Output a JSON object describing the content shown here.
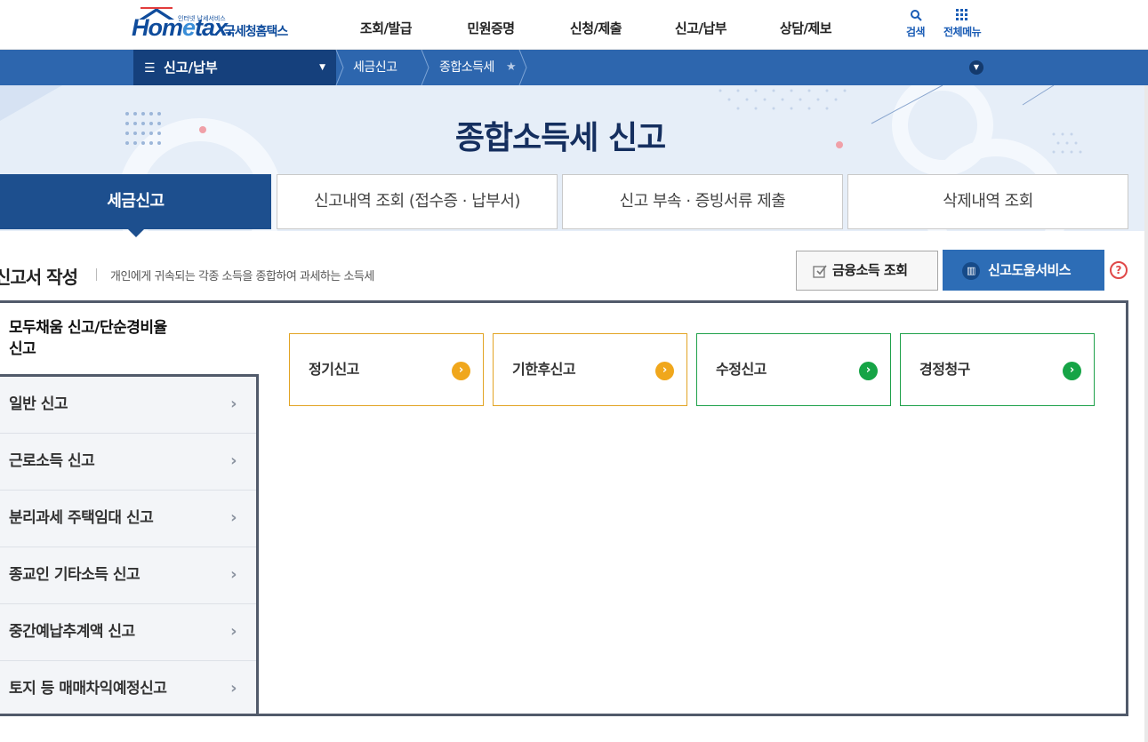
{
  "logo": {
    "brand_a": "Hom",
    "brand_e": "e",
    "brand_b": "tax.",
    "tagline": "인터넷 납세서비스",
    "agency": "국세청홈택스"
  },
  "gnb": [
    "조회/발급",
    "민원증명",
    "신청/제출",
    "신고/납부",
    "상담/제보"
  ],
  "util": {
    "search": "검색",
    "all_menu": "전체메뉴"
  },
  "navbar": {
    "menu": "신고/납부",
    "crumbs": [
      "세금신고",
      "종합소득세"
    ]
  },
  "hero": {
    "title": "종합소득세 신고"
  },
  "tabs": [
    "세금신고",
    "신고내역 조회 (접수증 · 납부서)",
    "신고 부속 · 증빙서류 제출",
    "삭제내역 조회"
  ],
  "section": {
    "title": "신고서 작성",
    "desc": "개인에게 귀속되는 각종 소득을 종합하여 과세하는 소득세"
  },
  "buttons": {
    "financial": "금융소득 조회",
    "help": "신고도움서비스",
    "question": "?"
  },
  "sidebar": {
    "active_line1": "모두채움 신고/단순경비율",
    "active_line2": "신고",
    "items": [
      "일반 신고",
      "근로소득 신고",
      "분리과세 주택임대 신고",
      "종교인 기타소득 신고",
      "중간예납추계액 신고",
      "토지 등 매매차익예정신고"
    ]
  },
  "cards": [
    {
      "label": "정기신고",
      "color": "#e2a424"
    },
    {
      "label": "기한후신고",
      "color": "#e2a424"
    },
    {
      "label": "수정신고",
      "color": "#1fa14a"
    },
    {
      "label": "경정청구",
      "color": "#1fa14a"
    }
  ],
  "colors": {
    "primary": "#2d66ae",
    "dark": "#15407c",
    "active_tab": "#1d4f8e",
    "help_btn": "#2d6db6",
    "question": "#e04848"
  }
}
